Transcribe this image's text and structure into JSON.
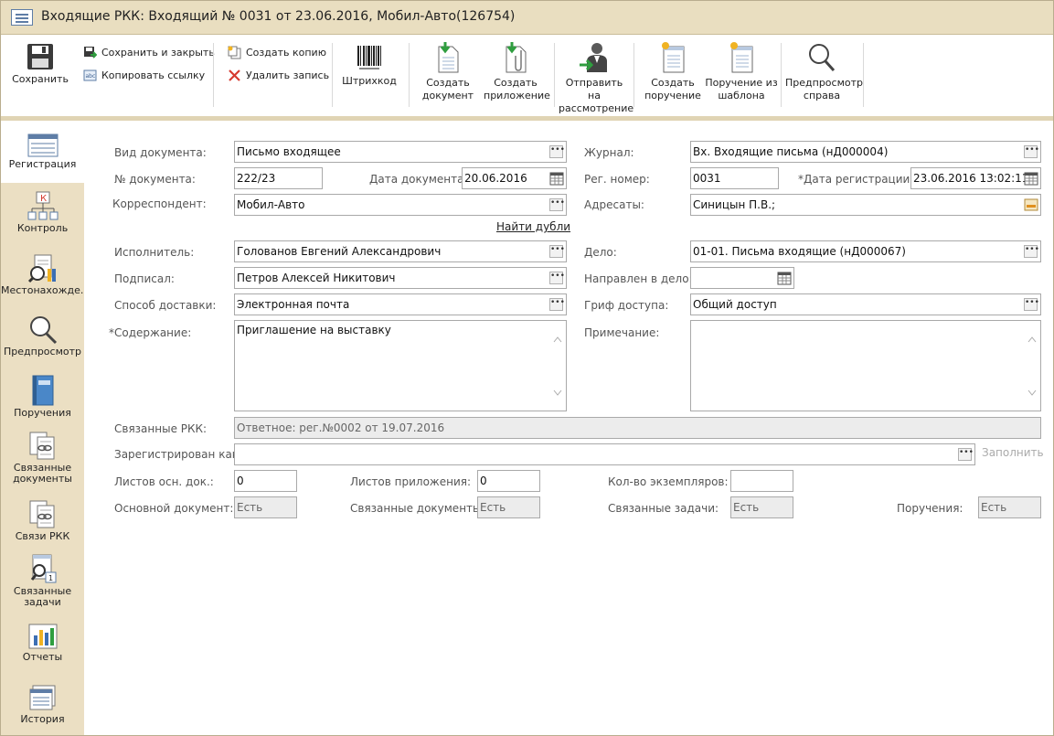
{
  "window": {
    "title": "Входящие РКК: Входящий № 0031 от 23.06.2016, Мобил-Авто(126754)"
  },
  "ribbon": {
    "save": "Сохранить",
    "save_close": "Сохранить и закрыть",
    "copy_link": "Копировать ссылку",
    "create_copy": "Создать копию",
    "delete_record": "Удалить запись",
    "barcode": "Штрихкод",
    "create_document": "Создать\nдокумент",
    "create_attachment": "Создать\nприложение",
    "send_review": "Отправить на\nрассмотрение",
    "create_task": "Создать\nпоручение",
    "task_template": "Поручение из\nшаблона",
    "preview_help": "Предпросмотр\nсправа"
  },
  "sidebar": {
    "items": [
      {
        "label": "Регистрация"
      },
      {
        "label": "Контроль"
      },
      {
        "label": "Местонахожде..."
      },
      {
        "label": "Предпросмотр"
      },
      {
        "label": "Поручения"
      },
      {
        "label": "Связанные\nдокументы"
      },
      {
        "label": "Связи РКК"
      },
      {
        "label": "Связанные\nзадачи"
      },
      {
        "label": "Отчеты"
      },
      {
        "label": "История"
      }
    ]
  },
  "form": {
    "doc_type": {
      "label": "Вид документа:",
      "value": "Письмо входящее"
    },
    "doc_number": {
      "label": "№ документа:",
      "value": "222/23"
    },
    "doc_date": {
      "label": "Дата документа:",
      "value": "20.06.2016"
    },
    "correspondent": {
      "label": "Корреспондент:",
      "value": "Мобил-Авто"
    },
    "find_duplicates": "Найти дубли",
    "executor": {
      "label": "Исполнитель:",
      "value": "Голованов Евгений Александрович"
    },
    "signed": {
      "label": "Подписал:",
      "value": "Петров Алексей Никитович"
    },
    "delivery": {
      "label": "Способ доставки:",
      "value": "Электронная почта"
    },
    "content": {
      "label": "*Содержание:",
      "value": "Приглашение на выставку"
    },
    "journal": {
      "label": "Журнал:",
      "value": "Вх. Входящие письма (нД000004)"
    },
    "reg_number": {
      "label": "Рег. номер:",
      "value": "0031"
    },
    "reg_date": {
      "label": "*Дата регистрации:",
      "value": "23.06.2016 13:02:11"
    },
    "addressees": {
      "label": "Адресаты:",
      "value": "Синицын П.В.;"
    },
    "case": {
      "label": "Дело:",
      "value": "01-01. Письма входящие (нД000067)"
    },
    "sent_to_case": {
      "label": "Направлен в дело:",
      "value": ""
    },
    "access": {
      "label": "Гриф доступа:",
      "value": "Общий доступ"
    },
    "note": {
      "label": "Примечание:",
      "value": ""
    },
    "linked_rkk": {
      "label": "Связанные РКК:",
      "value": "Ответное: рег.№0002 от 19.07.2016"
    },
    "registered_as": {
      "label": "Зарегистрирован как:",
      "value": ""
    },
    "fill": "Заполнить",
    "main_sheets": {
      "label": "Листов осн. док.:",
      "value": "0"
    },
    "attach_sheets": {
      "label": "Листов приложения:",
      "value": "0"
    },
    "copies": {
      "label": "Кол-во экземпляров:",
      "value": ""
    },
    "main_doc": {
      "label": "Основной документ:",
      "value": "Есть"
    },
    "linked_docs": {
      "label": "Связанные документы:",
      "value": "Есть"
    },
    "linked_tasks": {
      "label": "Связанные задачи:",
      "value": "Есть"
    },
    "tasks": {
      "label": "Поручения:",
      "value": "Есть"
    }
  }
}
